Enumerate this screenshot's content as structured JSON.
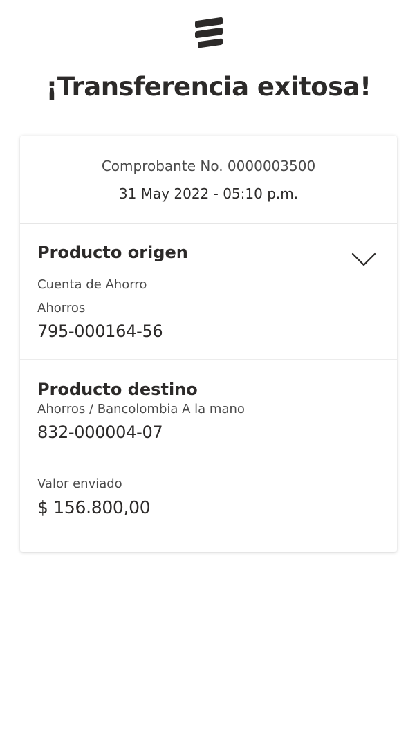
{
  "header": {
    "logo_icon": "bancolombia-logo-icon",
    "title": "¡Transferencia exitosa!"
  },
  "receipt": {
    "number": "Comprobante No. 0000003500",
    "datetime": "31 May 2022 - 05:10 p.m."
  },
  "origin": {
    "title": "Producto origen",
    "account_type": "Cuenta de Ahorro",
    "account_subtype": "Ahorros",
    "account_number": "795-000164-56",
    "toggle_icon": "chevron-down-icon"
  },
  "destination": {
    "title": "Producto destino",
    "account_desc": "Ahorros / Bancolombia A la mano",
    "account_number": "832-000004-07"
  },
  "amount": {
    "label": "Valor enviado",
    "value": "$ 156.800,00"
  },
  "colors": {
    "text_primary": "#2c2a29",
    "text_secondary": "#4a4a4a",
    "divider": "#e6e6e6",
    "background": "#ffffff"
  }
}
